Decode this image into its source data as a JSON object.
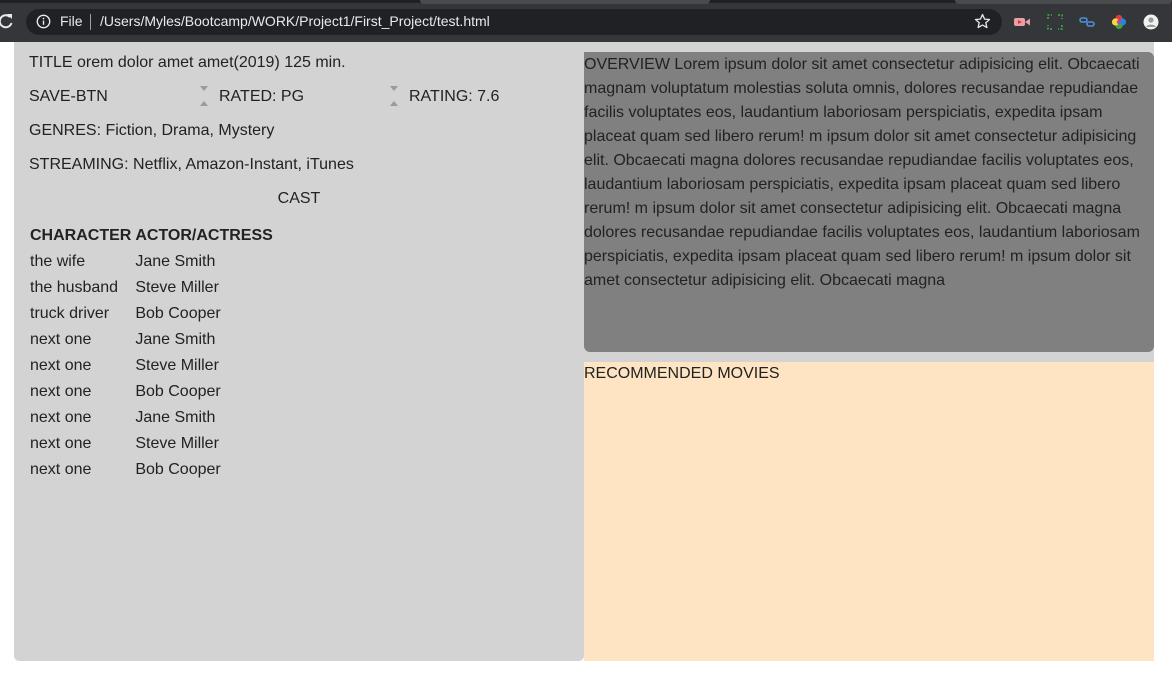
{
  "browser": {
    "scheme_label": "File",
    "url": "/Users/Myles/Bootcamp/WORK/Project1/First_Project/test.html"
  },
  "movie": {
    "title_line": "TITLE orem dolor amet amet(2019) 125 min.",
    "save_label": "SAVE-BTN",
    "rated_label": "RATED: PG",
    "rating_label": "RATING: 7.6",
    "genres_label": "GENRES: Fiction, Drama, Mystery",
    "streaming_label": "STREAMING: Netflix, Amazon-Instant, iTunes"
  },
  "cast": {
    "heading": "CAST",
    "headers": [
      "CHARACTER",
      "ACTOR/ACTRESS"
    ],
    "rows": [
      [
        "the wife",
        "Jane Smith"
      ],
      [
        "the husband",
        "Steve Miller"
      ],
      [
        "truck driver",
        "Bob Cooper"
      ],
      [
        "next one",
        "Jane Smith"
      ],
      [
        "next one",
        "Steve Miller"
      ],
      [
        "next one",
        "Bob Cooper"
      ],
      [
        "next one",
        "Jane Smith"
      ],
      [
        "next one",
        "Steve Miller"
      ],
      [
        "next one",
        "Bob Cooper"
      ]
    ]
  },
  "overview": {
    "text": "OVERVIEW Lorem ipsum dolor sit amet consectetur adipisicing elit. Obcaecati magnam voluptatum molestias soluta omnis, dolores recusandae repudiandae facilis voluptates eos, laudantium laboriosam perspiciatis, expedita ipsam placeat quam sed libero rerum! m ipsum dolor sit amet consectetur adipisicing elit. Obcaecati magna dolores recusandae repudiandae facilis voluptates eos, laudantium laboriosam perspiciatis, expedita ipsam placeat quam sed libero rerum! m ipsum dolor sit amet consectetur adipisicing elit. Obcaecati magna dolores recusandae repudiandae facilis voluptates eos, laudantium laboriosam perspiciatis, expedita ipsam placeat quam sed libero rerum! m ipsum dolor sit amet consectetur adipisicing elit. Obcaecati magna"
  },
  "recommended": {
    "title": "RECOMMENDED MOVIES"
  },
  "colors": {
    "chrome_bg": "#35363a",
    "omnibox_bg": "#202124",
    "left_panel_bg": "#d3d3d3",
    "overview_bg": "#808080",
    "recommended_bg": "#ffe4c4"
  },
  "icons": {
    "reload": "reload-icon",
    "info": "info-icon",
    "bookmark": "star-icon",
    "extensions": [
      "video-extension-icon",
      "screenshot-extension-icon",
      "link-extension-icon",
      "color-wheel-extension-icon",
      "profile-avatar-icon"
    ]
  }
}
